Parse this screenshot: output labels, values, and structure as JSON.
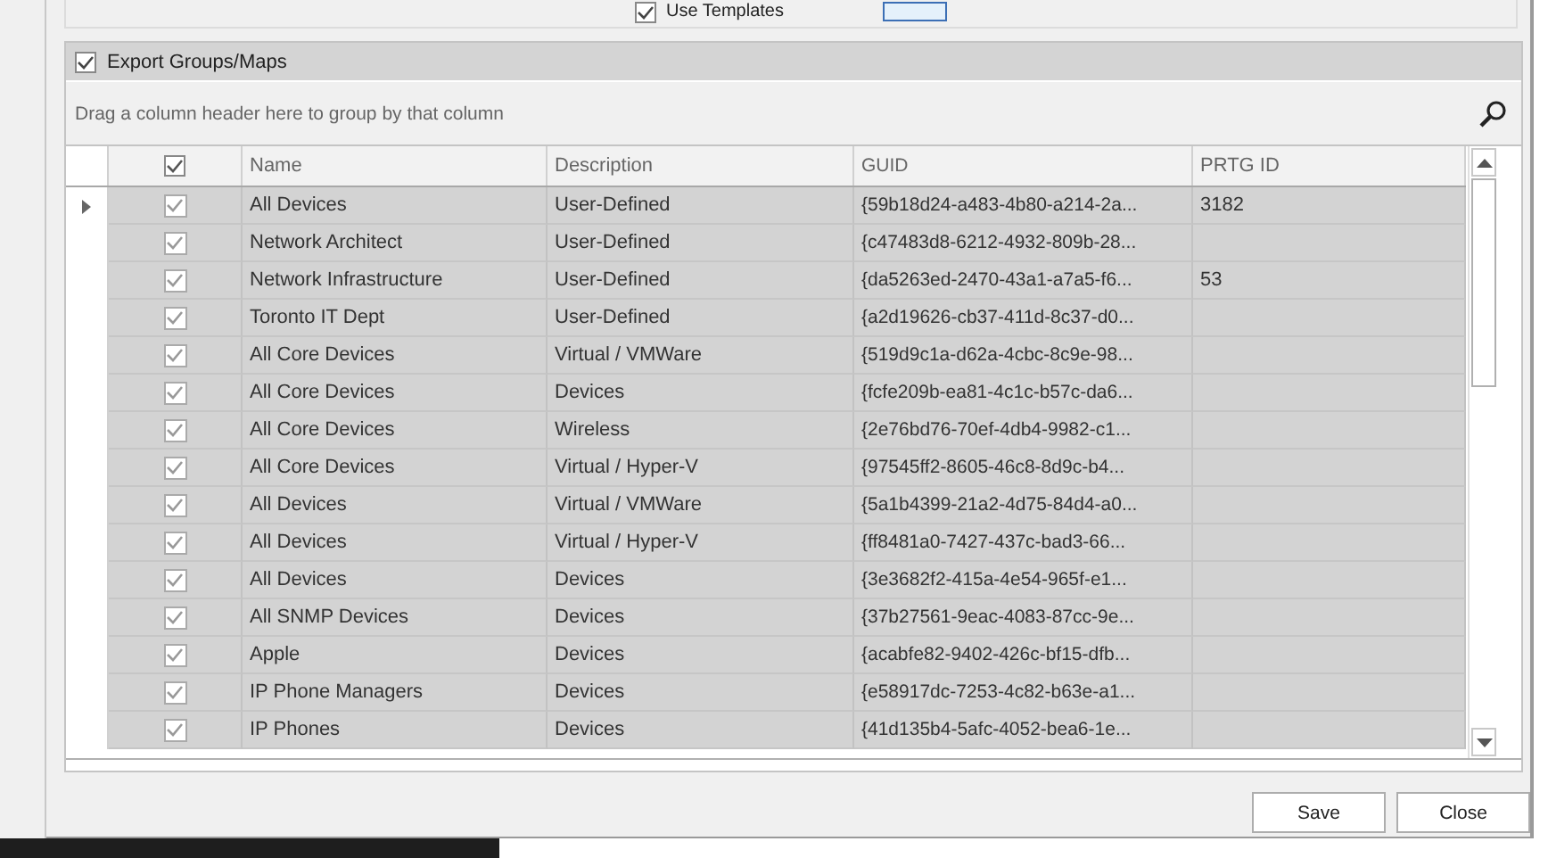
{
  "top_option": {
    "label": "Use Templates",
    "checked": true
  },
  "group": {
    "label": "Export Groups/Maps",
    "checked": true
  },
  "group_by_hint": "Drag a column header here to group by that column",
  "grid": {
    "header_checked": true,
    "columns": [
      "Name",
      "Description",
      "GUID",
      "PRTG ID"
    ],
    "rows": [
      {
        "focused": true,
        "checked": true,
        "cells": [
          "All Devices",
          "User-Defined",
          "{59b18d24-a483-4b80-a214-2a...",
          "3182"
        ]
      },
      {
        "focused": false,
        "checked": true,
        "cells": [
          "Network Architect",
          "User-Defined",
          "{c47483d8-6212-4932-809b-28...",
          ""
        ]
      },
      {
        "focused": false,
        "checked": true,
        "cells": [
          "Network Infrastructure",
          "User-Defined",
          "{da5263ed-2470-43a1-a7a5-f6...",
          "53"
        ]
      },
      {
        "focused": false,
        "checked": true,
        "cells": [
          "Toronto IT Dept",
          "User-Defined",
          "{a2d19626-cb37-411d-8c37-d0...",
          ""
        ]
      },
      {
        "focused": false,
        "checked": true,
        "cells": [
          "All Core Devices",
          "Virtual / VMWare",
          "{519d9c1a-d62a-4cbc-8c9e-98...",
          ""
        ]
      },
      {
        "focused": false,
        "checked": true,
        "cells": [
          "All Core Devices",
          "Devices",
          "{fcfe209b-ea81-4c1c-b57c-da6...",
          ""
        ]
      },
      {
        "focused": false,
        "checked": true,
        "cells": [
          "All Core Devices",
          "Wireless",
          "{2e76bd76-70ef-4db4-9982-c1...",
          ""
        ]
      },
      {
        "focused": false,
        "checked": true,
        "cells": [
          "All Core Devices",
          "Virtual / Hyper-V",
          "{97545ff2-8605-46c8-8d9c-b4...",
          ""
        ]
      },
      {
        "focused": false,
        "checked": true,
        "cells": [
          "All Devices",
          "Virtual / VMWare",
          "{5a1b4399-21a2-4d75-84d4-a0...",
          ""
        ]
      },
      {
        "focused": false,
        "checked": true,
        "cells": [
          "All Devices",
          "Virtual / Hyper-V",
          "{ff8481a0-7427-437c-bad3-66...",
          ""
        ]
      },
      {
        "focused": false,
        "checked": true,
        "cells": [
          "All Devices",
          "Devices",
          "{3e3682f2-415a-4e54-965f-e1...",
          ""
        ]
      },
      {
        "focused": false,
        "checked": true,
        "cells": [
          "All SNMP Devices",
          "Devices",
          "{37b27561-9eac-4083-87cc-9e...",
          ""
        ]
      },
      {
        "focused": false,
        "checked": true,
        "cells": [
          "Apple",
          "Devices",
          "{acabfe82-9402-426c-bf15-dfb...",
          ""
        ]
      },
      {
        "focused": false,
        "checked": true,
        "cells": [
          "IP Phone Managers",
          "Devices",
          "{e58917dc-7253-4c82-b63e-a1...",
          ""
        ]
      },
      {
        "focused": false,
        "checked": true,
        "cells": [
          "IP Phones",
          "Devices",
          "{41d135b4-5afc-4052-bea6-1e...",
          ""
        ]
      }
    ]
  },
  "buttons": [
    "Save",
    "Close"
  ]
}
